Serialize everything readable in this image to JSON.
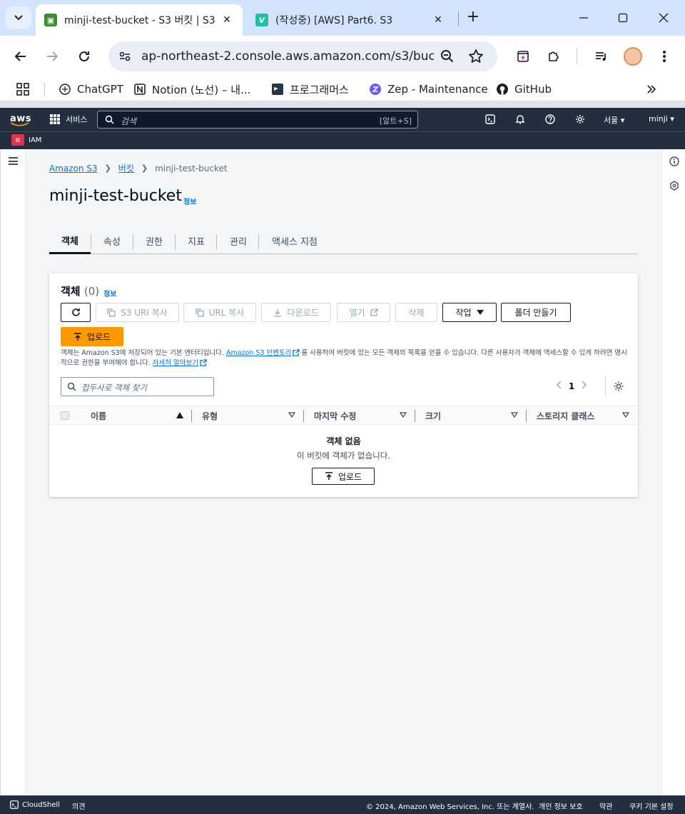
{
  "browser": {
    "tabs": [
      {
        "title": "minji-test-bucket - S3 버킷 | S3",
        "active": true
      },
      {
        "title": "(작성중) [AWS] Part6. S3",
        "active": false
      }
    ],
    "address": "ap-northeast-2.console.aws.amazon.com/s3/buck...",
    "bookmarks": [
      "ChatGPT",
      "Notion (노선) – 내...",
      "프로그래머스",
      "Zep - Maintenance",
      "GitHub"
    ]
  },
  "aws_header": {
    "logo": "aws",
    "services": "서비스",
    "search_placeholder": "검색",
    "search_shortcut": "[알트+S]",
    "region": "서울 ▾",
    "user": "minji ▾",
    "favorite": "IAM"
  },
  "breadcrumb": {
    "root": "Amazon S3",
    "buckets": "버킷",
    "current": "minji-test-bucket"
  },
  "page": {
    "title": "minji-test-bucket",
    "info": "정보"
  },
  "tabs": [
    "객체",
    "속성",
    "권한",
    "지표",
    "관리",
    "액세스 지점"
  ],
  "objects_panel": {
    "heading": "객체",
    "count": "(0)",
    "info": "정보",
    "buttons": {
      "copy_s3_uri": "S3 URI 복사",
      "copy_url": "URL 복사",
      "download": "다운로드",
      "open": "열기",
      "delete": "삭제",
      "actions": "작업",
      "create_folder": "폴더 만들기",
      "upload": "업로드"
    },
    "description": {
      "part1": "객체는 Amazon S3에 저장되어 있는 기본 엔터티입니다. ",
      "inventory_link": "Amazon S3 인벤토리",
      "part2": "를 사용하여 버킷에 있는 모든 객체의 목록을 얻을 수 있습니다. 다른 사용자가 객체에 액세스할 수 있게 하려면 명시적으로 권한을 부여해야 합니다. ",
      "learn_more": "자세히 알아보기"
    },
    "filter_placeholder": "접두사로 객체 찾기",
    "page_number": "1",
    "columns": [
      "이름",
      "유형",
      "마지막 수정",
      "크기",
      "스토리지 클래스"
    ],
    "empty_title": "객체 없음",
    "empty_message": "이 버킷에 객체가 없습니다.",
    "empty_upload": "업로드"
  },
  "footer": {
    "cloudshell": "CloudShell",
    "feedback": "의견",
    "copyright": "© 2024, Amazon Web Services, Inc. 또는 계열사.",
    "privacy": "개인 정보 보호",
    "terms": "약관",
    "cookies": "쿠키 기본 설정"
  },
  "colors": {
    "aws_header": "#232f3e",
    "primary_button": "#ff9900",
    "link": "#0972d3",
    "tab_strip": "#d3e3fd"
  }
}
